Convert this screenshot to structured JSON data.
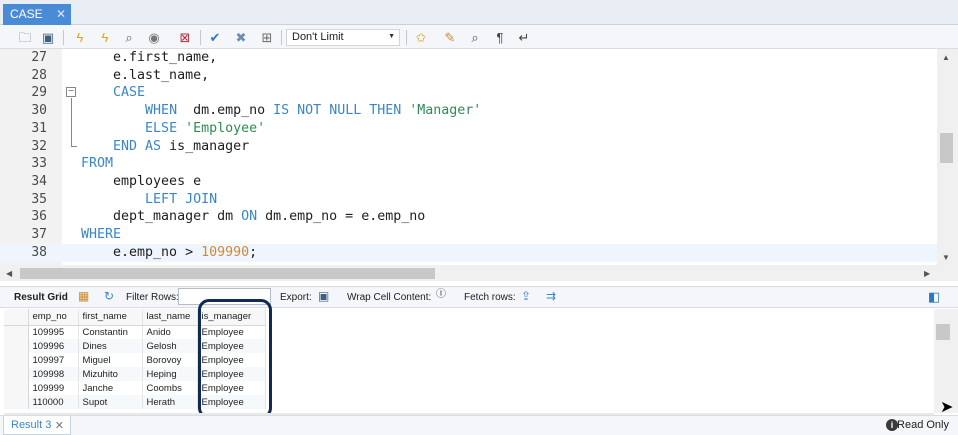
{
  "tab": {
    "title": "CASE",
    "close": "✕"
  },
  "toolbar": {
    "limit_value": "Don't Limit",
    "icons": [
      "open-folder-icon",
      "save-icon",
      "execute-icon",
      "execute-current-icon",
      "explain-icon",
      "stop-icon",
      "toggle-error-icon",
      "commit-icon",
      "rollback-icon",
      "autocommit-icon",
      "add-snippet-icon",
      "beautify-icon",
      "find-icon",
      "invisible-chars-icon",
      "wrap-icon"
    ]
  },
  "editor": {
    "lines": [
      {
        "n": "27",
        "code": [
          {
            "t": "    e.first_name,",
            "c": ""
          }
        ]
      },
      {
        "n": "28",
        "code": [
          {
            "t": "    e.last_name,",
            "c": ""
          }
        ]
      },
      {
        "n": "29",
        "code": [
          {
            "t": "    ",
            "c": ""
          },
          {
            "t": "CASE",
            "c": "kw"
          }
        ]
      },
      {
        "n": "30",
        "code": [
          {
            "t": "        ",
            "c": ""
          },
          {
            "t": "WHEN",
            "c": "kw"
          },
          {
            "t": "  dm.emp_no ",
            "c": ""
          },
          {
            "t": "IS NOT NULL THEN",
            "c": "kw"
          },
          {
            "t": " ",
            "c": ""
          },
          {
            "t": "'Manager'",
            "c": "str"
          }
        ]
      },
      {
        "n": "31",
        "code": [
          {
            "t": "        ",
            "c": ""
          },
          {
            "t": "ELSE",
            "c": "kw"
          },
          {
            "t": " ",
            "c": ""
          },
          {
            "t": "'Employee'",
            "c": "str"
          }
        ]
      },
      {
        "n": "32",
        "code": [
          {
            "t": "    ",
            "c": ""
          },
          {
            "t": "END AS",
            "c": "kw"
          },
          {
            "t": " is_manager",
            "c": ""
          }
        ]
      },
      {
        "n": "33",
        "code": [
          {
            "t": "FROM",
            "c": "kw"
          }
        ]
      },
      {
        "n": "34",
        "code": [
          {
            "t": "    employees e",
            "c": ""
          }
        ]
      },
      {
        "n": "35",
        "code": [
          {
            "t": "        ",
            "c": ""
          },
          {
            "t": "LEFT JOIN",
            "c": "kw"
          }
        ]
      },
      {
        "n": "36",
        "code": [
          {
            "t": "    dept_manager dm ",
            "c": ""
          },
          {
            "t": "ON",
            "c": "kw"
          },
          {
            "t": " dm.emp_no = e.emp_no",
            "c": ""
          }
        ]
      },
      {
        "n": "37",
        "code": [
          {
            "t": "WHERE",
            "c": "kw"
          }
        ]
      },
      {
        "n": "38",
        "code": [
          {
            "t": "    e.emp_no > ",
            "c": ""
          },
          {
            "t": "109990",
            "c": "num"
          },
          {
            "t": ";",
            "c": ""
          }
        ]
      }
    ]
  },
  "result_toolbar": {
    "result_grid": "Result Grid",
    "filter_rows": "Filter Rows:",
    "export": "Export:",
    "wrap_cell": "Wrap Cell Content:",
    "fetch_rows": "Fetch rows:"
  },
  "grid": {
    "columns": [
      "emp_no",
      "first_name",
      "last_name",
      "is_manager"
    ],
    "rows": [
      [
        "109995",
        "Constantin",
        "Anido",
        "Employee"
      ],
      [
        "109996",
        "Dines",
        "Gelosh",
        "Employee"
      ],
      [
        "109997",
        "Miguel",
        "Borovoy",
        "Employee"
      ],
      [
        "109998",
        "Mizuhito",
        "Heping",
        "Employee"
      ],
      [
        "109999",
        "Janche",
        "Coombs",
        "Employee"
      ],
      [
        "110000",
        "Supot",
        "Herath",
        "Employee"
      ]
    ]
  },
  "bottom": {
    "result_tab": "Result 3",
    "close": "✕",
    "status": "Read Only",
    "info": "i"
  },
  "colors": {
    "tab_active": "#4a8bd6",
    "keyword": "#3a86c8",
    "string": "#2f8a55",
    "number": "#d08a36",
    "highlight_box": "#0e2a55"
  }
}
